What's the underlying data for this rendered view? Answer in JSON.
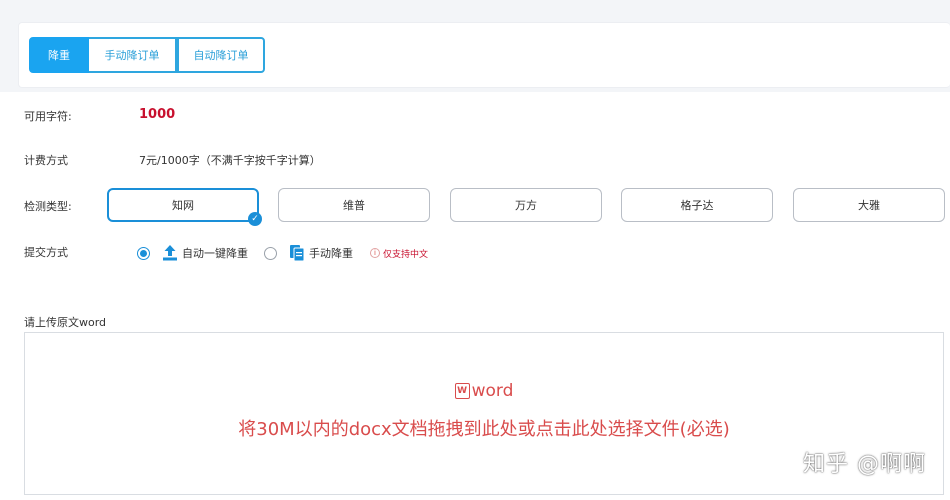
{
  "tabs": [
    {
      "label": "降重",
      "active": true
    },
    {
      "label": "手动降订单",
      "active": false
    },
    {
      "label": "自动降订单",
      "active": false
    }
  ],
  "available": {
    "label": "可用字符:",
    "value": "1000"
  },
  "billing": {
    "label": "计费方式",
    "value": "7元/1000字（不满千字按千字计算）"
  },
  "detect": {
    "label": "检测类型:",
    "options": [
      "知网",
      "维普",
      "万方",
      "格子达",
      "大雅"
    ],
    "selected": "知网"
  },
  "submit": {
    "label": "提交方式",
    "options": [
      {
        "label": "自动一键降重",
        "checked": true,
        "icon": "upload-icon"
      },
      {
        "label": "手动降重",
        "checked": false,
        "icon": "document-icon"
      }
    ],
    "note": "仅支持中文",
    "note_icon": "info-icon"
  },
  "upload": {
    "label": "请上传原文word",
    "title": "word",
    "hint": "将30M以内的docx文档拖拽到此处或点击此处选择文件(必选)",
    "icon": "word-icon"
  },
  "watermark": "知乎 @啊啊",
  "colors": {
    "accent": "#1aa4f0",
    "danger": "#c8102e",
    "hint": "#d94c4c"
  }
}
